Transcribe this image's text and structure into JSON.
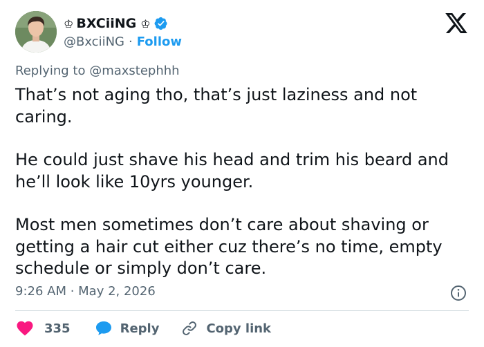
{
  "author": {
    "display_name": "BXCiiNG",
    "crown_left": "♔",
    "crown_right": "♔",
    "handle": "@BxciiNG",
    "separator": "·",
    "follow_label": "Follow",
    "verified_icon": "verified-badge-icon"
  },
  "reply_context": "Replying to @maxstephhh",
  "tweet": {
    "paragraphs": [
      "That’s not aging tho, that’s just laziness and not caring.",
      "He could just shave his head and trim his beard and he’ll look like 10yrs younger.",
      "Most men sometimes don’t care about shaving or getting a hair cut either cuz there’s no time, empty schedule or simply don’t care."
    ],
    "timestamp": "9:26 AM · May 2, 2026"
  },
  "actions": {
    "like_count": "335",
    "reply_label": "Reply",
    "copy_label": "Copy link"
  },
  "colors": {
    "accent": "#1d9bf0",
    "like": "#f91880",
    "text": "#0f1419",
    "secondary": "#536471",
    "divider": "#cfd9de"
  },
  "icons": [
    "x-logo-icon",
    "verified-badge-icon",
    "info-icon",
    "heart-icon",
    "speech-bubble-icon",
    "link-icon"
  ]
}
